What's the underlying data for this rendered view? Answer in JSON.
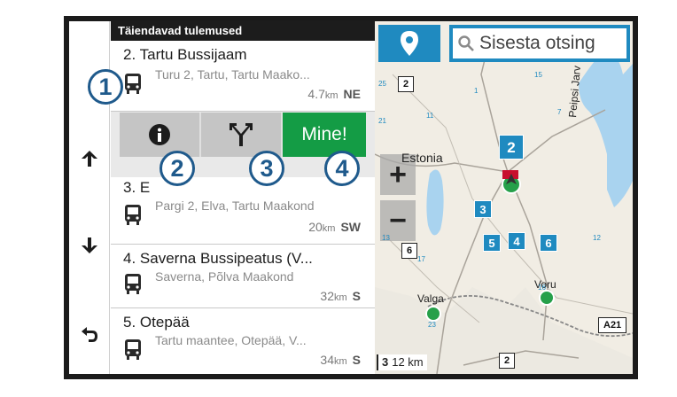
{
  "list": {
    "header": "Täiendavad tulemused",
    "rows": [
      {
        "index": "2.",
        "title": "Tartu Bussijaam",
        "address": "Turu 2, Tartu, Tartu Maako...",
        "distance": "4.7",
        "unit": "km",
        "direction": "NE"
      },
      {
        "index": "3.",
        "title": "E",
        "address": "Pargi 2, Elva, Tartu Maakond",
        "distance": "20",
        "unit": "km",
        "direction": "SW"
      },
      {
        "index": "4.",
        "title": "Saverna Bussipeatus (V...",
        "address": "Saverna, Põlva Maakond",
        "distance": "32",
        "unit": "km",
        "direction": "S"
      },
      {
        "index": "5.",
        "title": "Otepää",
        "address": "Tartu maantee, Otepää, V...",
        "distance": "34",
        "unit": "km",
        "direction": "S"
      }
    ]
  },
  "actions": {
    "go_label": "Mine!",
    "info_icon": "info-icon",
    "route_icon": "route-split-icon"
  },
  "callouts": [
    "1",
    "2",
    "3",
    "4"
  ],
  "nav": {
    "up_icon": "arrow-up-icon",
    "down_icon": "arrow-down-icon",
    "back_icon": "back-icon"
  },
  "map": {
    "search_placeholder": "Sisesta otsing",
    "zoom_in": "+",
    "zoom_out": "−",
    "country": "Estonia",
    "lake": "Peipsi Jarv",
    "city_valga": "Valga",
    "city_voru": "Voru",
    "road_2_top": "2",
    "road_6": "6",
    "road_a21": "A21",
    "road_2_bottom": "2",
    "road_3": "3",
    "scale": "12 km",
    "poi": [
      "2",
      "3",
      "4",
      "5",
      "6"
    ],
    "small_road_numbers": [
      "25",
      "15",
      "1",
      "21",
      "11",
      "7",
      "16",
      "17",
      "12",
      "23",
      "13"
    ],
    "colors": {
      "accent": "#1f8ac0",
      "go": "#149c45",
      "callout": "#1f5a8c",
      "lake": "#a9d3ef"
    }
  }
}
